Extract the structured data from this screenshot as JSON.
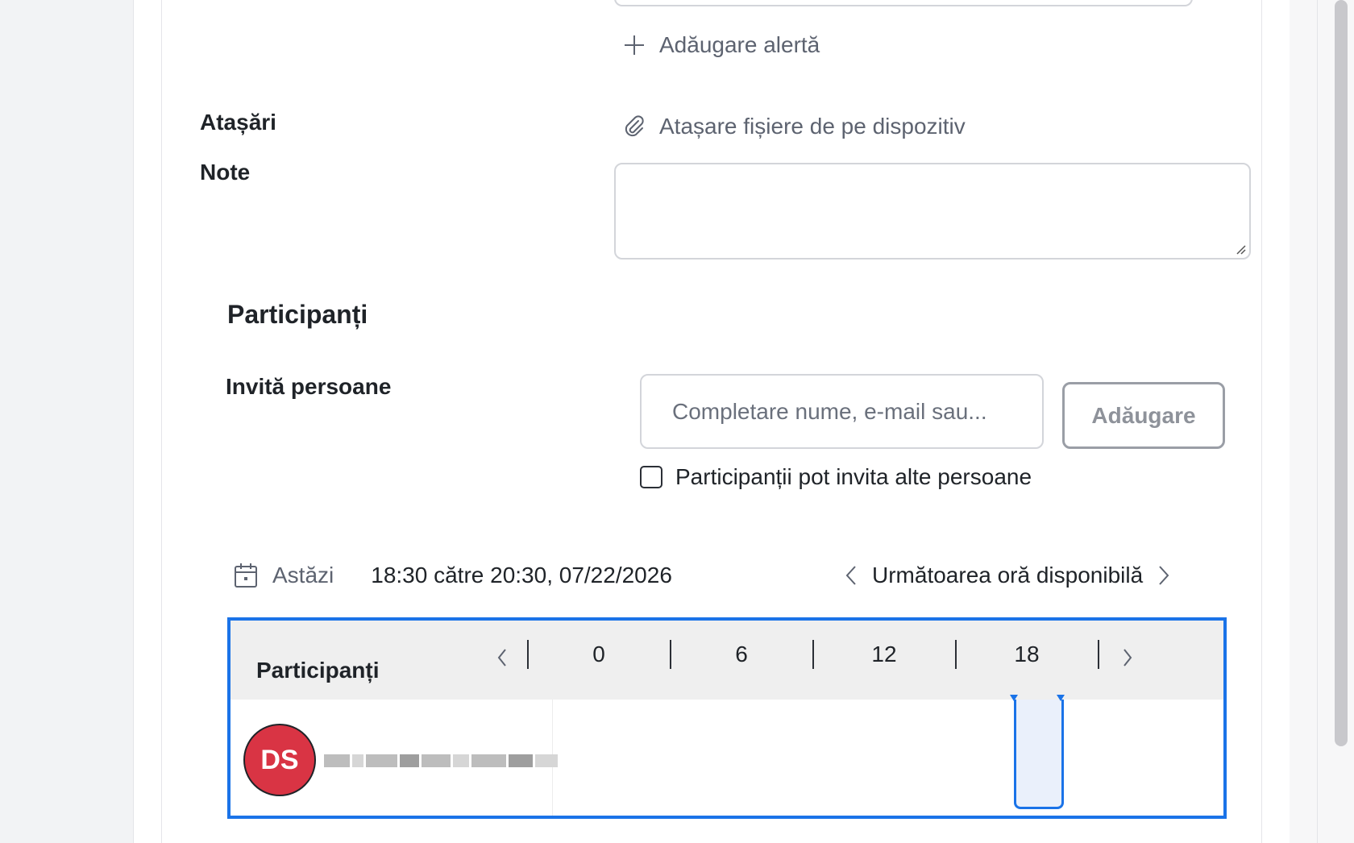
{
  "alerts": {
    "add_label": "Adăugare alertă"
  },
  "attachments": {
    "label": "Atașări",
    "attach_label": "Atașare fișiere de pe dispozitiv"
  },
  "notes": {
    "label": "Note",
    "value": ""
  },
  "participants": {
    "title": "Participanți",
    "invite_label": "Invită persoane",
    "invite_placeholder": "Completare nume, e-mail sau...",
    "add_button": "Adăugare",
    "can_invite_label": "Participanții pot invita alte persoane",
    "can_invite_checked": false
  },
  "schedule": {
    "today_label": "Astăzi",
    "range_text": "18:30 către 20:30, 07/22/2026",
    "next_available_label": "Următoarea oră disponibilă"
  },
  "timeline": {
    "title": "Participanți",
    "hours": [
      "0",
      "6",
      "12",
      "18"
    ],
    "attendees": [
      {
        "initials": "DS",
        "avatar_color": "#d93444"
      }
    ]
  },
  "colors": {
    "accent": "#1a73e8",
    "muted_text": "#5d6370",
    "avatar": "#d93444"
  }
}
